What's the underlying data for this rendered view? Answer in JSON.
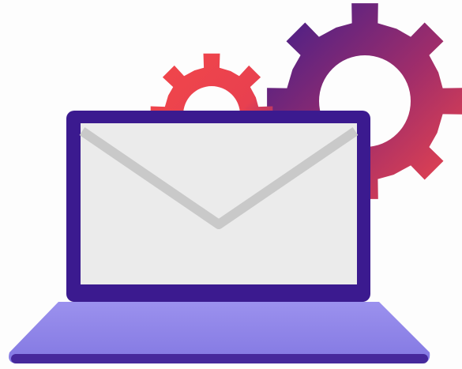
{
  "illustration": {
    "subject": "laptop-with-envelope-and-gears",
    "icons": [
      "gear-icon",
      "gear-icon",
      "laptop-icon",
      "envelope-icon"
    ]
  },
  "colors": {
    "background": "#fdfdfd",
    "laptop_frame": "#3b1a8f",
    "laptop_base": "#8f85e8",
    "laptop_base_shadow": "#7a6fdc",
    "envelope_fill": "#ebebeb",
    "envelope_flap": "#c9c9c9",
    "gear_red": "#f2474a",
    "gear_purple": "#4a1f8a"
  }
}
